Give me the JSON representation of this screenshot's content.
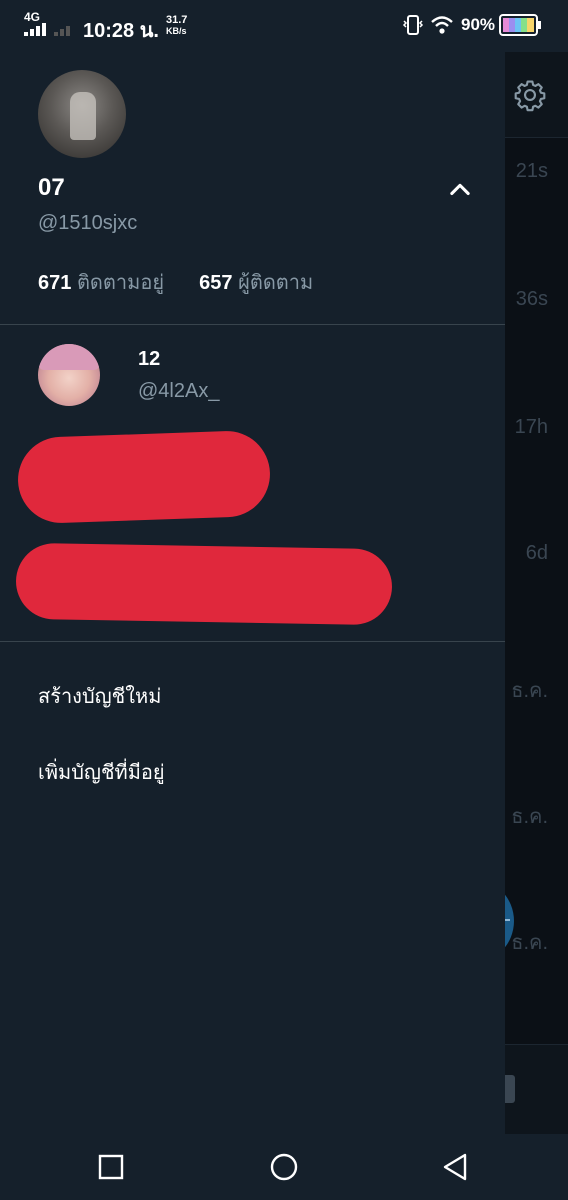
{
  "status_bar": {
    "network": "4G",
    "time": "10:28 น.",
    "speed_value": "31.7",
    "speed_unit": "KB/s",
    "battery": "90%"
  },
  "drawer": {
    "profile": {
      "name": "07",
      "handle": "@1510sjxc",
      "following_count": "671",
      "following_label": "ติดตามอยู่",
      "followers_count": "657",
      "followers_label": "ผู้ติดตาม"
    },
    "accounts": [
      {
        "name": "12",
        "handle": "@4l2Ax_"
      }
    ],
    "menu": {
      "create_account": "สร้างบัญชีใหม่",
      "add_existing": "เพิ่มบัญชีที่มีอยู่"
    }
  },
  "timeline": {
    "times": [
      "21s",
      "36s",
      "17h",
      "6d",
      "ธ.ค.",
      "ธ.ค.",
      "ธ.ค."
    ]
  },
  "colors": {
    "drawer_bg": "#15202b",
    "secondary_text": "#8899a6",
    "divider": "#38444d",
    "redaction": "#e0283c"
  }
}
